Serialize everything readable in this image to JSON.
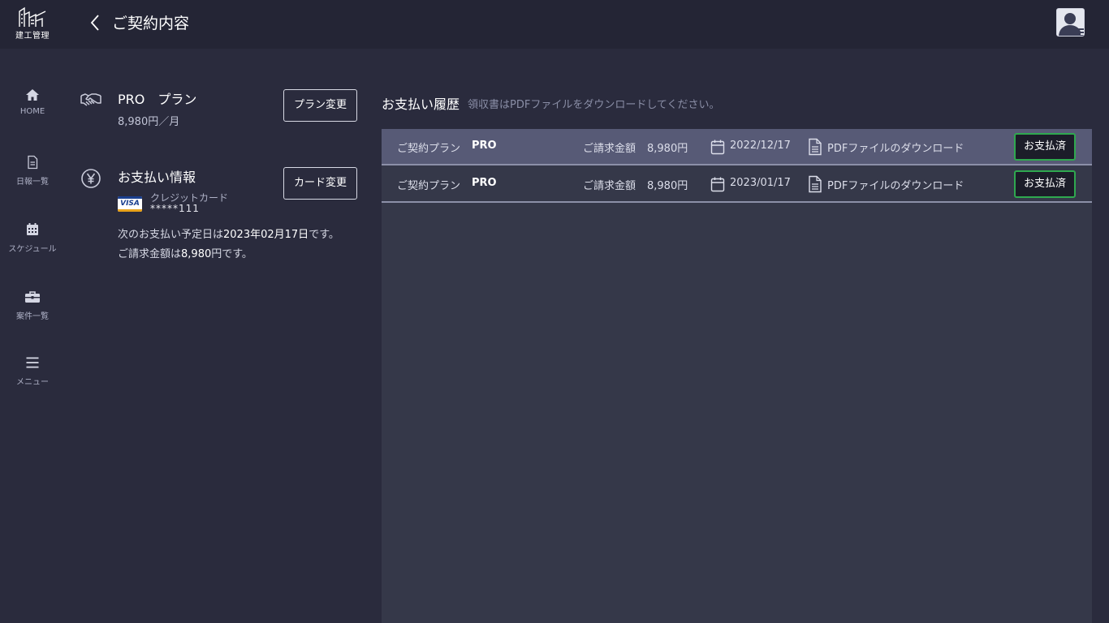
{
  "header": {
    "logo_text": "建工管理",
    "title": "ご契約内容"
  },
  "sidebar": {
    "items": [
      {
        "label": "HOME",
        "icon": "home-icon"
      },
      {
        "label": "日報一覧",
        "icon": "document-icon"
      },
      {
        "label": "スケジュール",
        "icon": "calendar-icon"
      },
      {
        "label": "案件一覧",
        "icon": "briefcase-icon"
      },
      {
        "label": "メニュー",
        "icon": "hamburger-icon"
      }
    ]
  },
  "plan": {
    "name": "PRO　プラン",
    "price": "8,980円／月",
    "change_button": "プラン変更"
  },
  "payment_info": {
    "title": "お支払い情報",
    "card_brand": "VISA",
    "card_type": "クレジットカード",
    "card_number": "*****111",
    "change_button": "カード変更",
    "next_date_prefix": "次のお支払い予定日は",
    "next_date": "2023年02月17日",
    "next_date_suffix": "です。",
    "amount_prefix": "ご請求金額は",
    "amount": "8,980",
    "amount_suffix": "円です。"
  },
  "history": {
    "title": "お支払い履歴",
    "note": "領収書はPDFファイルをダウンロードしてください。",
    "rows": [
      {
        "plan_label": "ご契約プラン",
        "plan": "PRO",
        "amount_label": "ご請求金額",
        "amount": "8,980円",
        "date": "2022/12/17",
        "download": "PDFファイルのダウンロード",
        "status": "お支払済"
      },
      {
        "plan_label": "ご契約プラン",
        "plan": "PRO",
        "amount_label": "ご請求金額",
        "amount": "8,980円",
        "date": "2023/01/17",
        "download": "PDFファイルのダウンロード",
        "status": "お支払済"
      }
    ]
  },
  "colors": {
    "background": "#2a2b3d",
    "topbar": "#242535",
    "panel": "#353849",
    "selected_row": "#575a76",
    "paid_border": "#2fa84f"
  }
}
